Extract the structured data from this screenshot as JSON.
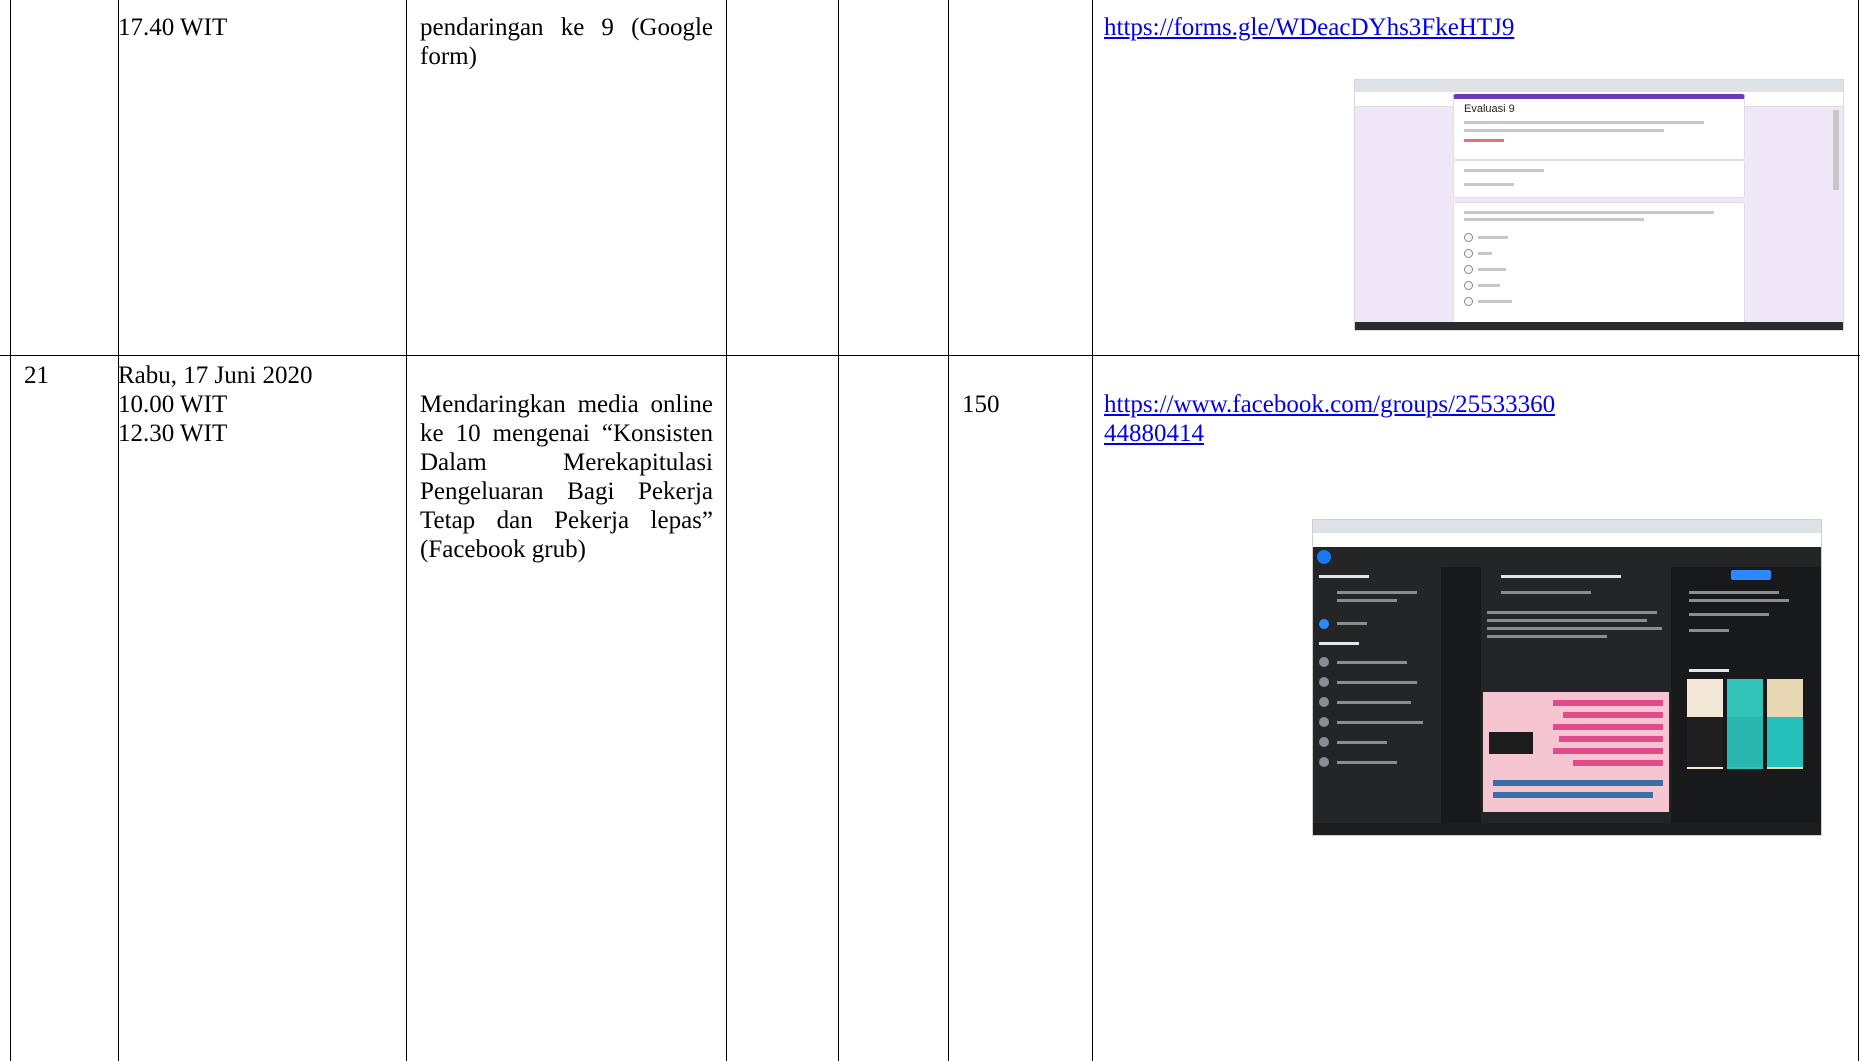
{
  "rows": [
    {
      "no": "",
      "datetime": [
        "17.40 WIT"
      ],
      "activity": "pendaringan ke 9 (Google form)",
      "col4": "",
      "col5": "",
      "count": "",
      "link": "https://forms.gle/WDeacDYhs3FkeHTJ9",
      "thumbnail": {
        "title": "Evaluasi 9"
      }
    },
    {
      "no": "21",
      "datetime": [
        "Rabu, 17 Juni 2020",
        "10.00 WIT",
        "12.30 WIT"
      ],
      "activity": "Mendaringkan media online ke 10 mengenai “Konsisten Dalam Merekapitulasi Pengeluaran Bagi Pekerja Tetap dan Pekerja lepas” (Facebook grub)",
      "col4": "",
      "col5": "",
      "count": "150",
      "link_line1": "https://www.facebook.com/groups/25533360",
      "link_line2": "44880414"
    }
  ]
}
